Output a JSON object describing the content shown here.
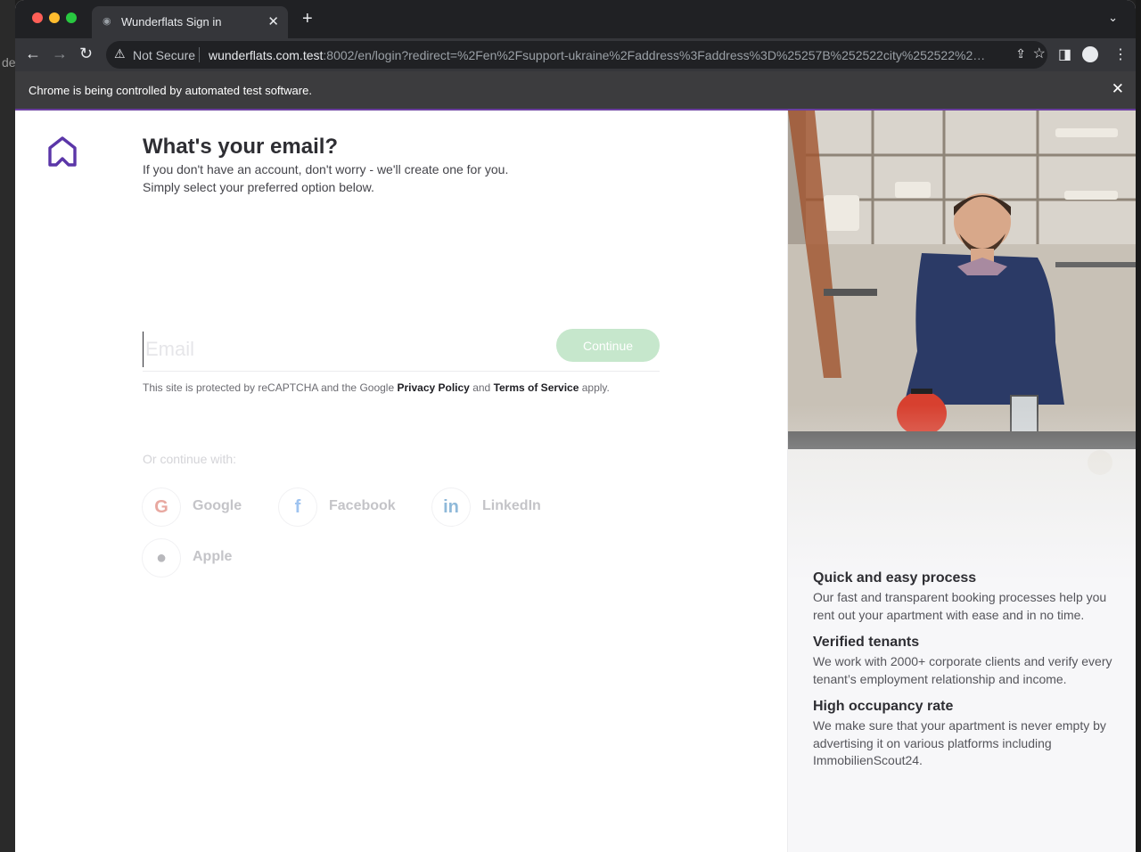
{
  "desktop": {
    "left_fragment": "de"
  },
  "browser": {
    "tab_title": "Wunderflats Sign in",
    "tab_close": "✕",
    "new_tab": "+",
    "security_label": "Not Secure",
    "url_host": "wunderflats.com.test",
    "url_rest": ":8002/en/login?redirect=%2Fen%2Fsupport-ukraine%2Faddress%3Faddress%3D%25257B%252522city%252522%25...",
    "automation_message": "Chrome is being controlled by automated test software.",
    "infobar_close": "✕"
  },
  "login": {
    "title": "What's your email?",
    "subtitle": "If you don't have an account, don't worry - we'll create one for you. Simply select your preferred option below.",
    "email_placeholder": "Email",
    "email_value": "",
    "continue_label": "Continue",
    "recaptcha_prefix": "This site is protected by reCAPTCHA and the Google ",
    "privacy_link": "Privacy Policy",
    "recaptcha_and": " and ",
    "terms_link": "Terms of Service",
    "recaptcha_suffix": " apply.",
    "or_continue": "Or continue with:",
    "providers": [
      {
        "label": "Google",
        "icon": "google-icon",
        "color": "#4285F4"
      },
      {
        "label": "Facebook",
        "icon": "facebook-icon",
        "color": "#1877F2"
      },
      {
        "label": "LinkedIn",
        "icon": "linkedin-icon",
        "color": "#0A66C2"
      },
      {
        "label": "Apple",
        "icon": "apple-icon",
        "color": "#000000"
      }
    ]
  },
  "features": [
    {
      "title": "Quick and easy process",
      "text": "Our fast and transparent booking processes help you rent out your apartment with ease and in no time."
    },
    {
      "title": "Verified tenants",
      "text": "We work with 2000+ corporate clients and verify every tenant’s employment relationship and income."
    },
    {
      "title": "High occupancy rate",
      "text": "We make sure that your apartment is never empty by advertising it on various platforms including ImmobilienScout24."
    }
  ],
  "colors": {
    "brand_purple": "#5b36a8",
    "continue_disabled": "#c6e7cc",
    "infobar_accent": "#6b3fa0"
  }
}
